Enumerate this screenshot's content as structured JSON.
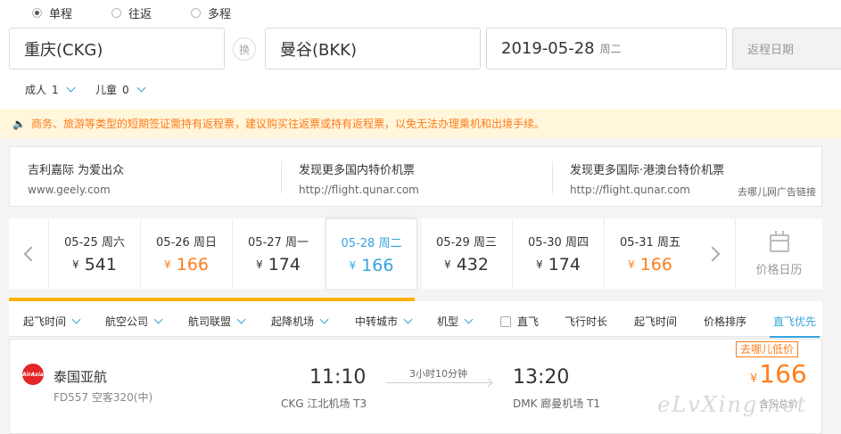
{
  "trip_types": [
    {
      "label": "单程",
      "selected": true
    },
    {
      "label": "往返",
      "selected": false
    },
    {
      "label": "多程",
      "selected": false
    }
  ],
  "search": {
    "from": "重庆(CKG)",
    "swap_label": "换",
    "to": "曼谷(BKK)",
    "depart_date": "2019-05-28",
    "depart_weekday": "周二",
    "return_placeholder": "返程日期"
  },
  "passengers": {
    "adults_label": "成人",
    "adults_count": "1",
    "children_label": "儿童",
    "children_count": "0"
  },
  "notice": {
    "icon": "speaker-icon",
    "text": "商务、旅游等类型的短期签证需持有返程票，建议购买往返票或持有返程票，以免无法办理乘机和出境手续。"
  },
  "ads": [
    {
      "title": "吉利嘉际 为爱出众",
      "url": "www.geely.com"
    },
    {
      "title": "发现更多国内特价机票",
      "url": "http://flight.qunar.com"
    },
    {
      "title": "发现更多国际·港澳台特价机票",
      "url": "http://flight.qunar.com"
    }
  ],
  "ad_link": "去哪儿网广告链接",
  "date_strip": {
    "currency": "¥",
    "days": [
      {
        "date": "05-25 周六",
        "price": "541",
        "low": false,
        "selected": false
      },
      {
        "date": "05-26 周日",
        "price": "166",
        "low": true,
        "selected": false
      },
      {
        "date": "05-27 周一",
        "price": "174",
        "low": false,
        "selected": false
      },
      {
        "date": "05-28 周二",
        "price": "166",
        "low": false,
        "selected": true
      },
      {
        "date": "05-29 周三",
        "price": "432",
        "low": false,
        "selected": false
      },
      {
        "date": "05-30 周四",
        "price": "174",
        "low": false,
        "selected": false
      },
      {
        "date": "05-31 周五",
        "price": "166",
        "low": true,
        "selected": false
      }
    ],
    "calendar_label": "价格日历"
  },
  "filters": [
    {
      "label": "起飞时间",
      "dropdown": true
    },
    {
      "label": "航空公司",
      "dropdown": true
    },
    {
      "label": "航司联盟",
      "dropdown": true
    },
    {
      "label": "起降机场",
      "dropdown": true
    },
    {
      "label": "中转城市",
      "dropdown": true
    },
    {
      "label": "机型",
      "dropdown": true
    },
    {
      "label": "直飞",
      "checkbox": true
    },
    {
      "label": "飞行时长"
    },
    {
      "label": "起飞时间"
    },
    {
      "label": "价格排序"
    },
    {
      "label": "直飞优先",
      "active": true
    }
  ],
  "flight": {
    "logo_text": "AirAsia",
    "airline": "泰国亚航",
    "flight_no": "FD557 空客320(中)",
    "dep_time": "11:10",
    "dep_airport": "CKG 江北机场 T3",
    "duration": "3小时10分钟",
    "arr_time": "13:20",
    "arr_airport": "DMK 廊曼机场 T1",
    "tag": "去哪儿低价",
    "currency": "¥",
    "price": "166",
    "price_note": "含税总价"
  },
  "watermark": "eLvXing.net",
  "colors": {
    "accent": "#36a3dd",
    "price_orange": "#ff7d1a",
    "notice_bg": "#fff6db",
    "bar_yellow": "#ffb200"
  }
}
